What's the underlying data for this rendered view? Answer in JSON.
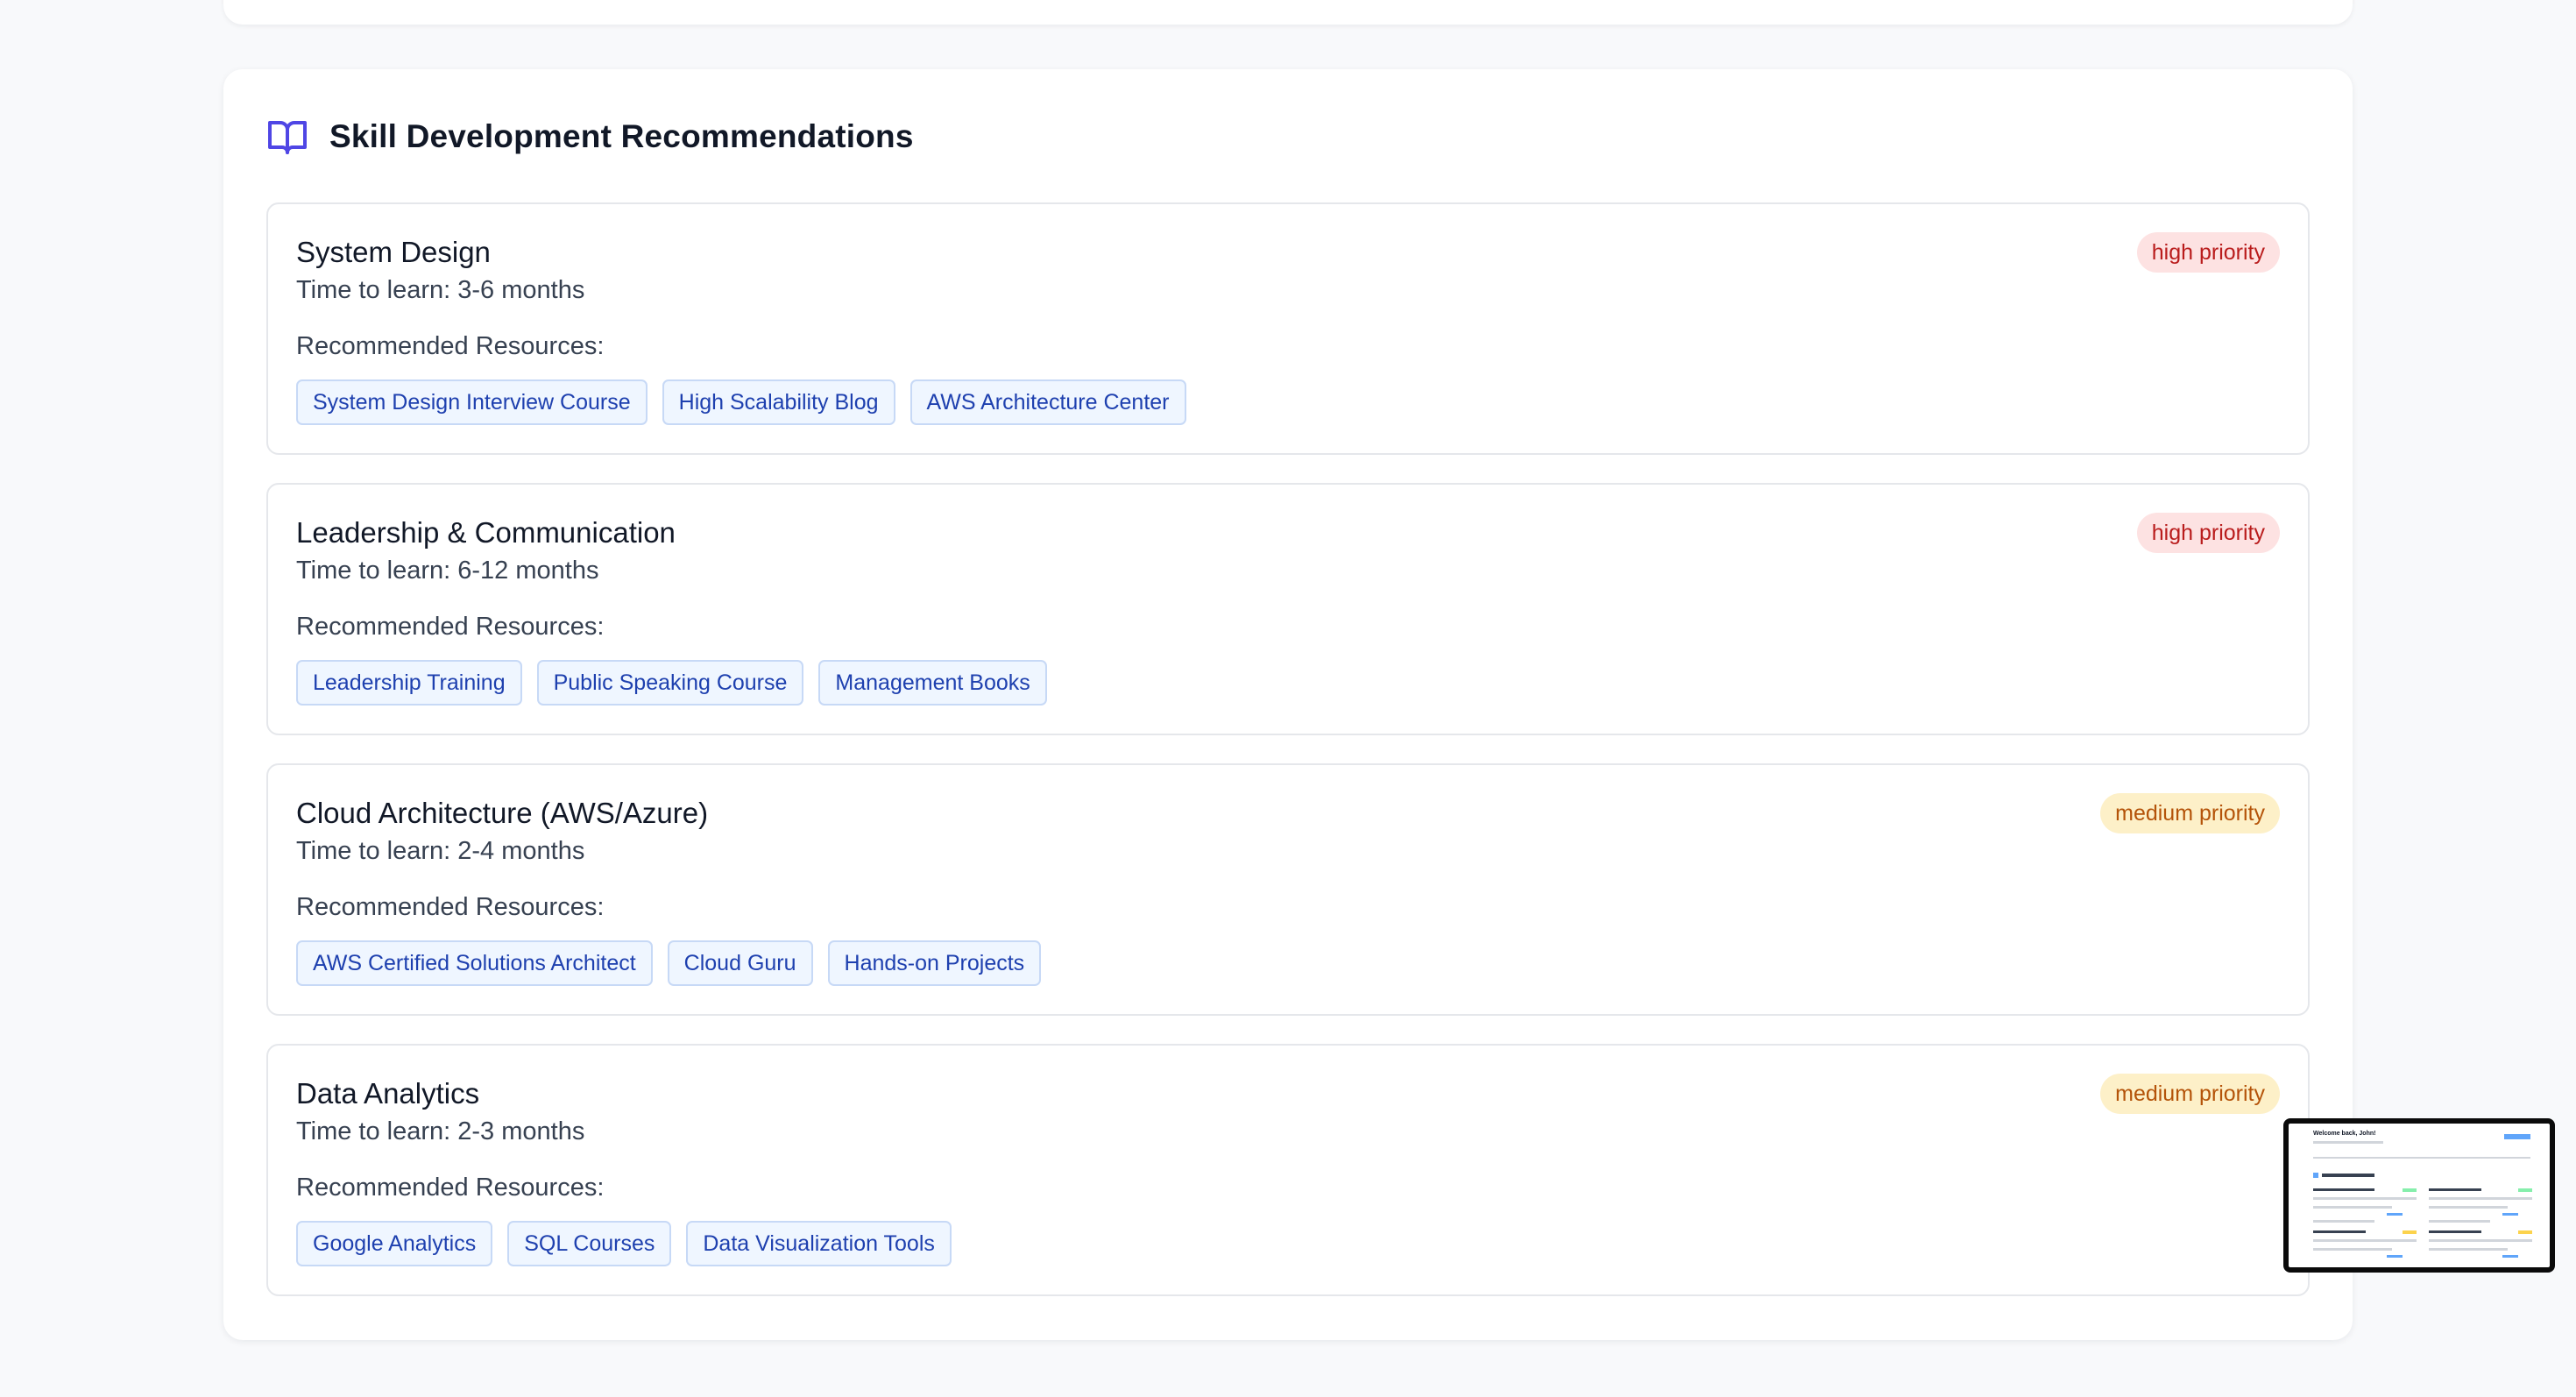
{
  "section": {
    "title": "Skill Development Recommendations",
    "icon": "book-open-icon"
  },
  "skills": [
    {
      "name": "System Design",
      "time": "Time to learn: 3-6 months",
      "priority": "high priority",
      "resources_label": "Recommended Resources:",
      "resources": [
        "System Design Interview Course",
        "High Scalability Blog",
        "AWS Architecture Center"
      ]
    },
    {
      "name": "Leadership & Communication",
      "time": "Time to learn: 6-12 months",
      "priority": "high priority",
      "resources_label": "Recommended Resources:",
      "resources": [
        "Leadership Training",
        "Public Speaking Course",
        "Management Books"
      ]
    },
    {
      "name": "Cloud Architecture (AWS/Azure)",
      "time": "Time to learn: 2-4 months",
      "priority": "medium priority",
      "resources_label": "Recommended Resources:",
      "resources": [
        "AWS Certified Solutions Architect",
        "Cloud Guru",
        "Hands-on Projects"
      ]
    },
    {
      "name": "Data Analytics",
      "time": "Time to learn: 2-3 months",
      "priority": "medium priority",
      "resources_label": "Recommended Resources:",
      "resources": [
        "Google Analytics",
        "SQL Courses",
        "Data Visualization Tools"
      ]
    }
  ],
  "colors": {
    "accent_icon": "#4f46e5",
    "high_priority_bg": "#fde2e2",
    "high_priority_text": "#b91c1c",
    "medium_priority_bg": "#fdf0c8",
    "medium_priority_text": "#b45309",
    "tag_bg": "#eff6ff",
    "tag_text": "#1e40af"
  },
  "thumbnail": {
    "title": "Welcome back, John!"
  }
}
